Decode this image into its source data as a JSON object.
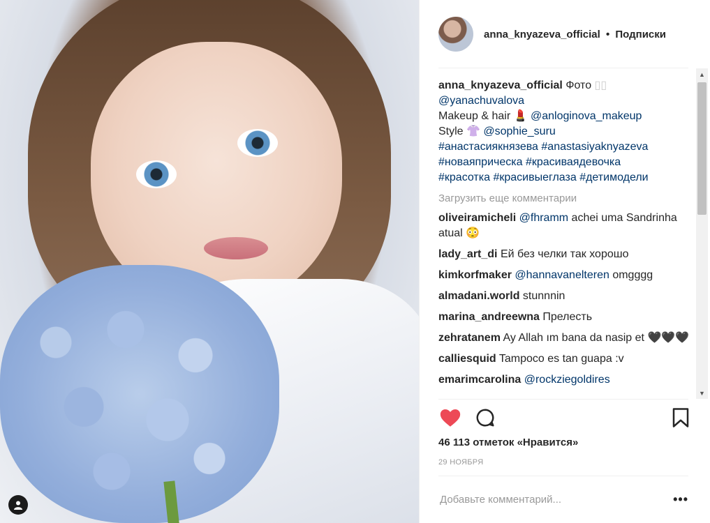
{
  "header": {
    "username": "anna_knyazeva_official",
    "separator": "•",
    "follow_label": "Подписки"
  },
  "caption": {
    "username": "anna_knyazeva_official",
    "line1_text": "Фото",
    "photographer": "@yanachuvalova",
    "makeup_prefix": "Makeup & hair 💄",
    "makeup_link": "@anloginova_makeup",
    "style_prefix": "Style 👚",
    "style_link": "@sophie_suru",
    "hashtags_line1": "#анастасиякнязева #anastasiyaknyazeva",
    "hashtags_line2": "#новаяприческа #красиваядевочка",
    "hashtags_line3": "#красотка #красивыеглаза #детимодели"
  },
  "load_more": "Загрузить еще комментарии",
  "comments": [
    {
      "user": "oliveiramicheli",
      "mention": "@fhramm",
      "text": "achei uma Sandrinha atual 😳"
    },
    {
      "user": "lady_art_di",
      "mention": "",
      "text": "Ей без челки так хорошо"
    },
    {
      "user": "kimkorfmaker",
      "mention": "@hannavanelteren",
      "text": "omgggg"
    },
    {
      "user": "almadani.world",
      "mention": "",
      "text": "stunnnin"
    },
    {
      "user": "marina_andreewna",
      "mention": "",
      "text": "Прелесть"
    },
    {
      "user": "zehratanem",
      "mention": "",
      "text": "Ay Allah ım bana da nasip et 🖤🖤🖤"
    },
    {
      "user": "calliesquid",
      "mention": "",
      "text": "Tampoco es tan guapa :v"
    },
    {
      "user": "emarimcarolina",
      "mention": "@rockziegoldires",
      "text": ""
    }
  ],
  "likes": "46 113 отметок «Нравится»",
  "date": "29 НОЯБРЯ",
  "add_comment_placeholder": "Добавьте комментарий...",
  "more_label": "•••",
  "colors": {
    "heart": "#ed4956",
    "link": "#003569",
    "muted": "#999999"
  },
  "icons": [
    "heart-icon",
    "comment-icon",
    "bookmark-icon",
    "user-tag-icon"
  ]
}
